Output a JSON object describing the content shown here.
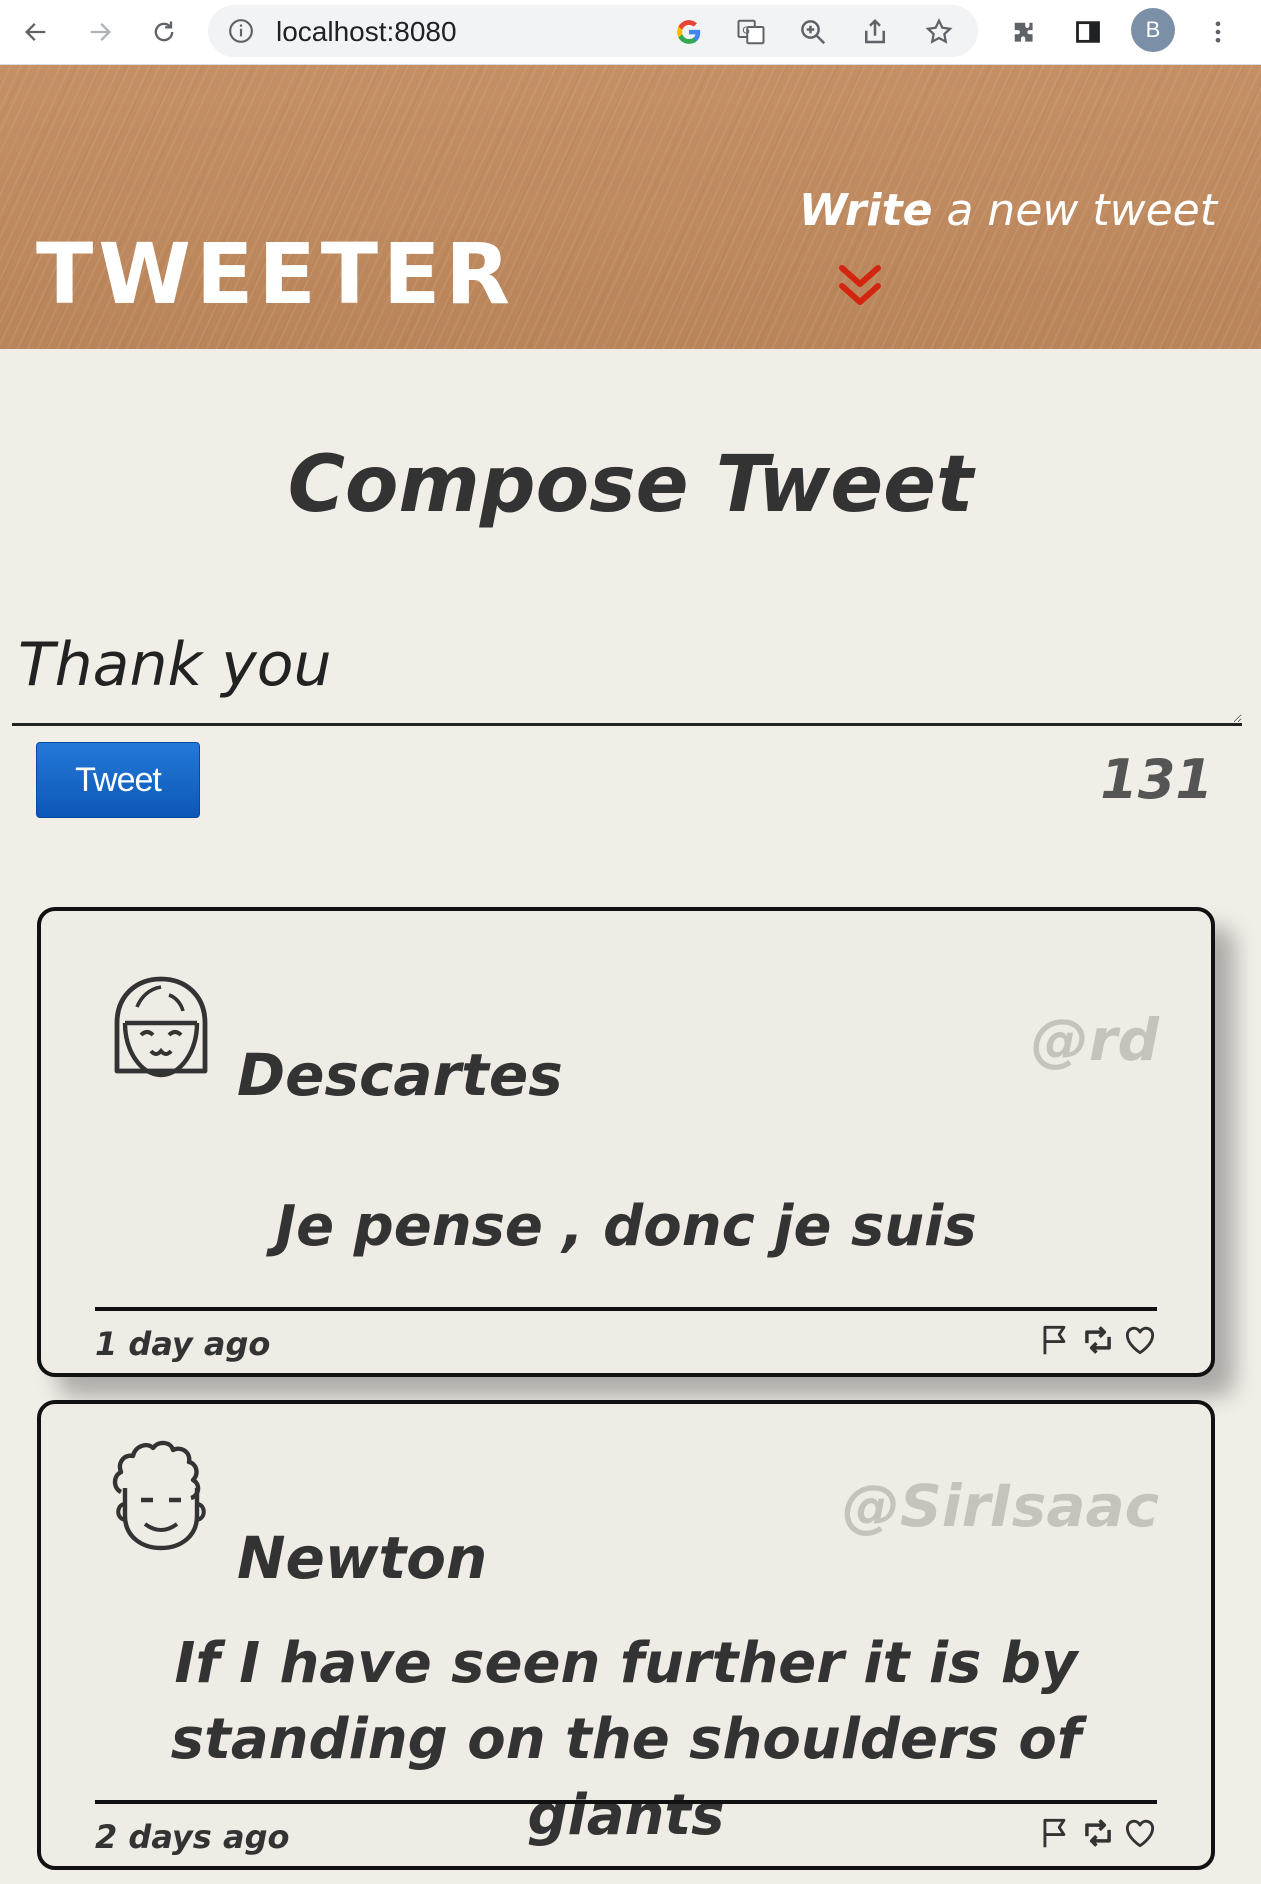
{
  "browser": {
    "url": "localhost:8080",
    "profile_initial": "B"
  },
  "header": {
    "brand": "TWEETER",
    "write_bold": "Write",
    "write_rest": " a new tweet",
    "accent_color": "#d3250f"
  },
  "compose": {
    "title": "Compose Tweet",
    "input_value": "Thank you",
    "button_label": "Tweet",
    "counter": "131"
  },
  "tweets": [
    {
      "name": "Descartes",
      "handle": "@rd",
      "content": "Je pense , donc je suis",
      "time": "1 day ago",
      "avatar_icon": "girl-face-icon"
    },
    {
      "name": "Newton",
      "handle": "@SirIsaac",
      "content": "If I have seen further it is by standing on the shoulders of giants",
      "time": "2 days ago",
      "avatar_icon": "curly-hair-face-icon"
    }
  ],
  "actions": [
    "flag-icon",
    "retweet-icon",
    "heart-icon"
  ]
}
